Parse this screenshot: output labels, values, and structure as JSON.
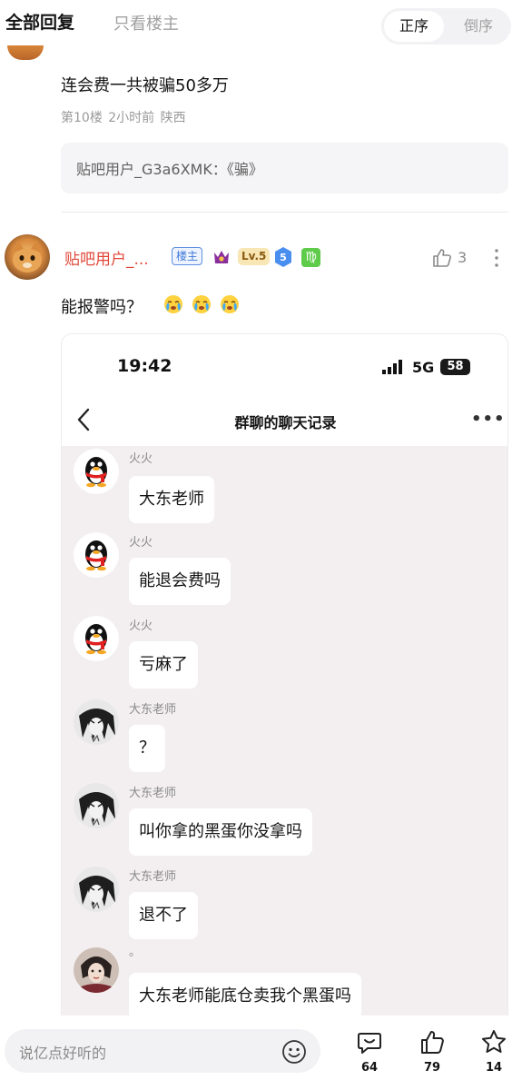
{
  "tabs": {
    "all_replies": "全部回复",
    "only_op": "只看楼主"
  },
  "sort": {
    "asc": "正序",
    "desc": "倒序"
  },
  "floor10": {
    "text": "连会费一共被骗50多万",
    "meta": "第10楼 2小时前 陕西",
    "sub_reply": "贴吧用户_G3a6XMK：《骗》"
  },
  "floor_post": {
    "username": "贴吧用户_...",
    "host_badge": "楼主",
    "level": "Lv.5",
    "gem_level": "5",
    "zodiac": "♍",
    "likes": "3",
    "text": "能报警吗？"
  },
  "phone": {
    "time": "19:42",
    "network": "5G",
    "battery": "58",
    "title": "群聊的聊天记录",
    "more": "•••"
  },
  "messages": [
    {
      "name": "火火",
      "text": "大东老师"
    },
    {
      "name": "火火",
      "text": "能退会费吗"
    },
    {
      "name": "火火",
      "text": "亏麻了"
    },
    {
      "name": "大东老师",
      "text": "？"
    },
    {
      "name": "大东老师",
      "text": "叫你拿的黑蛋你没拿吗"
    },
    {
      "name": "大东老师",
      "text": "退不了"
    },
    {
      "name": "。",
      "text": "大东老师能底仓卖我个黑蛋吗"
    }
  ],
  "bottom": {
    "placeholder": "说亿点好听的",
    "comments": "64",
    "likes": "79",
    "favorites": "14"
  }
}
